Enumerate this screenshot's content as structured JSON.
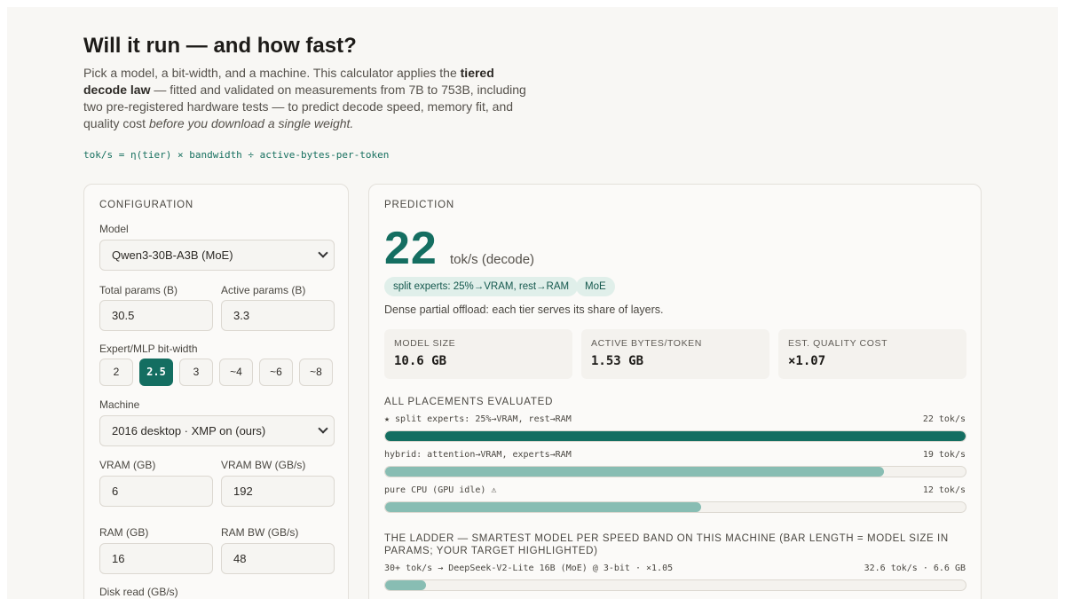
{
  "header": {
    "title": "Will it run — and how fast?",
    "intro_part1": "Pick a model, a bit-width, and a machine. This calculator applies the ",
    "intro_bold": "tiered decode law",
    "intro_part2": " — fitted and validated on measurements from 7B to 753B, including two pre-registered hardware tests — to predict decode speed, memory fit, and quality cost ",
    "intro_italic": "before you download a single weight.",
    "formula": "tok/s = η(tier) × bandwidth ÷ active-bytes-per-token"
  },
  "config": {
    "section_label": "CONFIGURATION",
    "model_label": "Model",
    "model_value": "Qwen3-30B-A3B (MoE)",
    "total_params_label": "Total params (B)",
    "total_params_value": "30.5",
    "active_params_label": "Active params (B)",
    "active_params_value": "3.3",
    "bitwidth_label": "Expert/MLP bit-width",
    "bitwidths": [
      "2",
      "2.5",
      "3",
      "~4",
      "~6",
      "~8"
    ],
    "bitwidth_selected": "2.5",
    "machine_label": "Machine",
    "machine_value": "2016 desktop · XMP on (ours)",
    "vram_label": "VRAM (GB)",
    "vram_value": "6",
    "vram_bw_label": "VRAM BW (GB/s)",
    "vram_bw_value": "192",
    "ram_label": "RAM (GB)",
    "ram_value": "16",
    "ram_bw_label": "RAM BW (GB/s)",
    "ram_bw_value": "48",
    "disk_label": "Disk read (GB/s)"
  },
  "prediction": {
    "section_label": "PREDICTION",
    "speed": "22",
    "speed_unit": "tok/s (decode)",
    "tags": [
      "split experts: 25%→VRAM, rest→RAM",
      "MoE"
    ],
    "note": "Dense partial offload: each tier serves its share of layers.",
    "stats": [
      {
        "label": "MODEL SIZE",
        "value": "10.6 GB"
      },
      {
        "label": "ACTIVE BYTES/TOKEN",
        "value": "1.53 GB"
      },
      {
        "label": "EST. QUALITY COST",
        "value": "×1.07"
      }
    ],
    "placements_label": "ALL PLACEMENTS EVALUATED",
    "placements": [
      {
        "name": "★ split experts: 25%→VRAM, rest→RAM",
        "speed": "22 tok/s",
        "fraction": 1.0,
        "best": true
      },
      {
        "name": "hybrid: attention→VRAM, experts→RAM",
        "speed": "19 tok/s",
        "fraction": 0.86,
        "best": false
      },
      {
        "name": "pure CPU (GPU idle) ⚠",
        "speed": "12 tok/s",
        "fraction": 0.545,
        "best": false
      }
    ],
    "ladder_label": "THE LADDER — SMARTEST MODEL PER SPEED BAND ON THIS MACHINE (BAR LENGTH = MODEL SIZE IN PARAMS; YOUR TARGET HIGHLIGHTED)",
    "ladder": [
      {
        "name": "30+ tok/s → DeepSeek-V2-Lite 16B (MoE) @ 3-bit · ×1.05",
        "right": "32.6 tok/s · 6.6 GB",
        "fraction": 0.07
      }
    ]
  },
  "colors": {
    "accent": "#146e61",
    "bar_best": "#146e61",
    "bar_other": "#88bdb3",
    "pill_bg": "#e0efea"
  }
}
